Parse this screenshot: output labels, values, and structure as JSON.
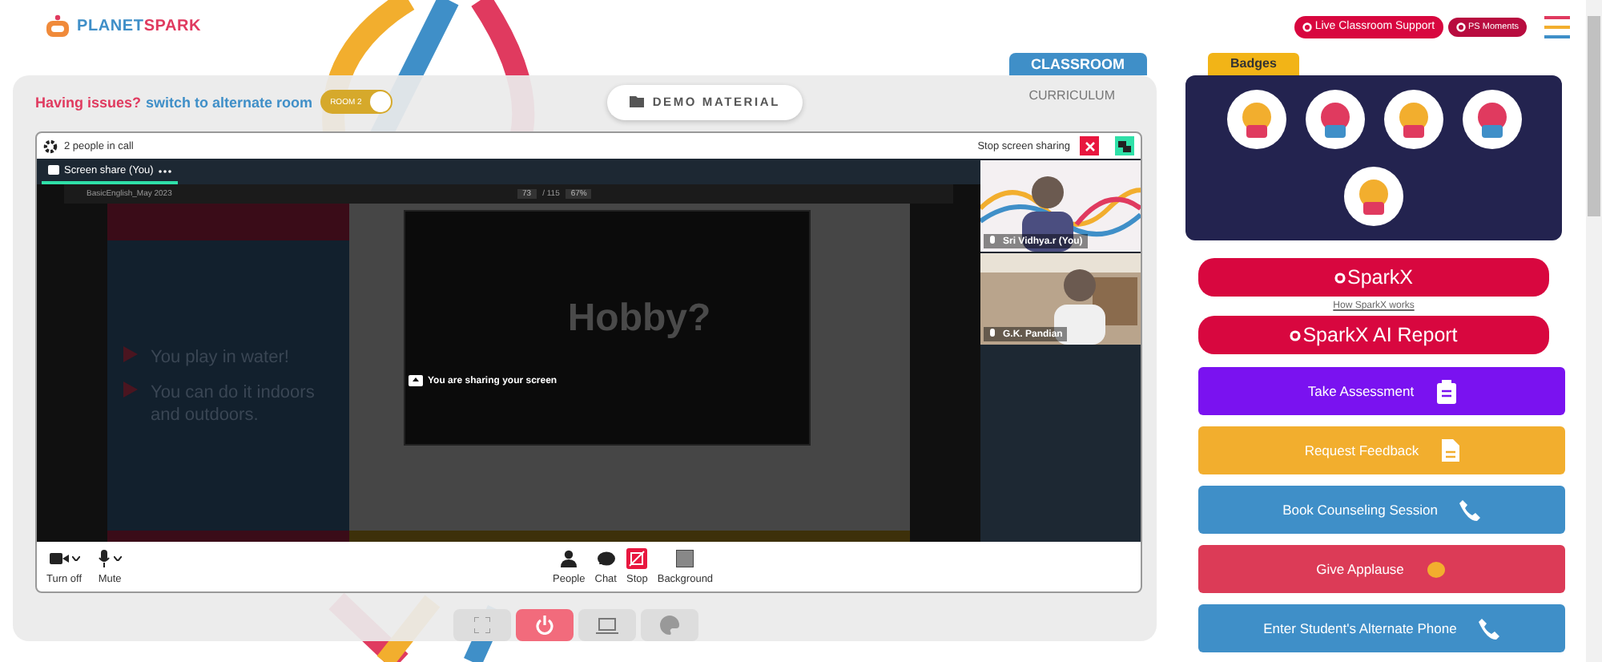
{
  "logo": {
    "part_1": "PLANET",
    "part_2": "SPARK"
  },
  "header_buttons": [
    {
      "label": "Live Classroom Support",
      "kind": "large"
    },
    {
      "label": "PS Moments",
      "kind": "small"
    }
  ],
  "issue_bar": {
    "question": "Having issues?",
    "link": "switch to alternate room",
    "toggle": {
      "label": "ROOM 2",
      "on": true
    }
  },
  "demo_button": "DEMO MATERIAL",
  "tabs": [
    {
      "label": "CLASSROOM",
      "selected": true
    },
    {
      "label": "CURRICULUM",
      "selected": false
    }
  ],
  "call": {
    "people": "2 people in call",
    "stop_label": "Stop screen sharing",
    "share_tab": "Screen share (You)",
    "sharing_notice": "You are sharing your screen",
    "document": {
      "file": "BasicEnglish_May 2023",
      "page": "73",
      "pages": "/ 115",
      "zoom": "67%",
      "slide_title": "Hobby?",
      "bullets": [
        "You play in water!",
        "You can do it indoors and outdoors."
      ]
    },
    "participants": [
      {
        "name": "Sri Vidhya.r (You)"
      },
      {
        "name": "G.K. Pandian"
      }
    ],
    "controls_left": [
      {
        "label": "Turn off",
        "kind": "camera"
      },
      {
        "label": "Mute",
        "kind": "mic"
      }
    ],
    "controls_center": [
      {
        "label": "People",
        "kind": "people"
      },
      {
        "label": "Chat",
        "kind": "chat"
      },
      {
        "label": "Stop",
        "kind": "stop"
      },
      {
        "label": "Background",
        "kind": "background"
      }
    ]
  },
  "bottom_buttons": [
    {
      "kind": "fullscreen"
    },
    {
      "kind": "power"
    },
    {
      "kind": "screen"
    },
    {
      "kind": "palette"
    }
  ],
  "badges": {
    "title": "Badges"
  },
  "sparkx": [
    {
      "label": "SparkX"
    },
    {
      "label": "SparkX AI Report"
    }
  ],
  "sparkx_link": "How SparkX works",
  "actions": [
    {
      "label": "Take Assessment",
      "color": "#7a12f0",
      "kind": "clipboard"
    },
    {
      "label": "Request Feedback",
      "color": "#f2ae2e",
      "kind": "document"
    },
    {
      "label": "Book Counseling Session",
      "color": "#3f8fc8",
      "kind": "phone"
    },
    {
      "label": "Give Applause",
      "color": "#dc3b57",
      "kind": "clap"
    },
    {
      "label": "Enter Student's Alternate Phone",
      "color": "#3f8fc8",
      "kind": "phone"
    }
  ]
}
